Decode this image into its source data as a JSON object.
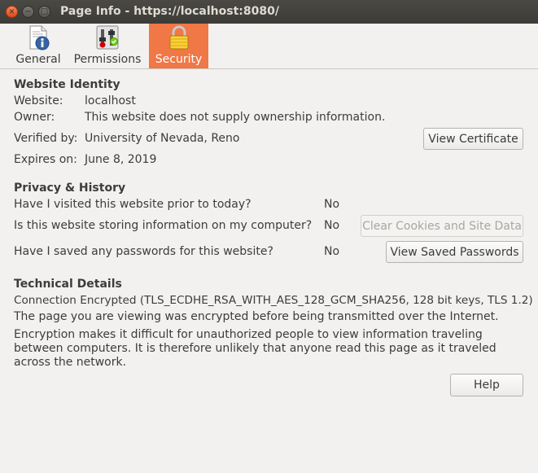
{
  "window": {
    "title": "Page Info - https://localhost:8080/",
    "close_glyph": "×",
    "minimize_glyph": "−",
    "maximize_glyph": "□"
  },
  "tabs": [
    {
      "label": "General",
      "icon": "info-page-icon"
    },
    {
      "label": "Permissions",
      "icon": "permissions-switches-icon"
    },
    {
      "label": "Security",
      "icon": "padlock-icon",
      "active": true
    }
  ],
  "identity": {
    "heading": "Website Identity",
    "website_label": "Website:",
    "website_value": "localhost",
    "owner_label": "Owner:",
    "owner_value": "This website does not supply ownership information.",
    "verified_label": "Verified by:",
    "verified_value": "University of Nevada, Reno",
    "expires_label": "Expires on:",
    "expires_value": "June 8, 2019",
    "view_certificate": "View Certificate"
  },
  "privacy": {
    "heading": "Privacy & History",
    "q1": "Have I visited this website prior to today?",
    "a1": "No",
    "q2": "Is this website storing information on my computer?",
    "a2": "No",
    "clear_cookies": "Clear Cookies and Site Data",
    "q3": "Have I saved any passwords for this website?",
    "a3": "No",
    "view_passwords": "View Saved Passwords"
  },
  "technical": {
    "heading": "Technical Details",
    "line1": "Connection Encrypted (TLS_ECDHE_RSA_WITH_AES_128_GCM_SHA256, 128 bit keys, TLS 1.2)",
    "line2": "The page you are viewing was encrypted before being transmitted over the Internet.",
    "line3": "Encryption makes it difficult for unauthorized people to view information traveling between computers. It is therefore unlikely that anyone read this page as it traveled across the network."
  },
  "help_button": "Help",
  "colors": {
    "accent": "#f07746",
    "titlebar": "#3c3b37",
    "background": "#f2f1f0"
  }
}
